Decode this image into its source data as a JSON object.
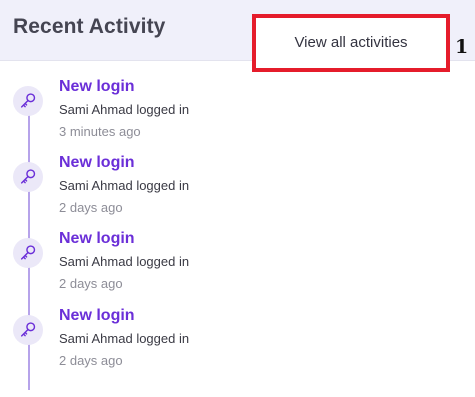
{
  "header": {
    "title": "Recent Activity",
    "view_all_label": "View all activities",
    "annotation_marker": "1"
  },
  "activities": [
    {
      "icon": "key-icon",
      "title": "New login",
      "description": "Sami Ahmad logged in",
      "time": "3 minutes ago"
    },
    {
      "icon": "key-icon",
      "title": "New login",
      "description": "Sami Ahmad logged in",
      "time": "2 days ago"
    },
    {
      "icon": "key-icon",
      "title": "New login",
      "description": "Sami Ahmad logged in",
      "time": "2 days ago"
    },
    {
      "icon": "key-icon",
      "title": "New login",
      "description": "Sami Ahmad logged in",
      "time": "2 days ago"
    }
  ],
  "colors": {
    "accent": "#6b2fd8",
    "timeline": "#b6a3ea",
    "icon_bg": "#ebe8f8",
    "highlight_border": "#e51c2b",
    "header_bg": "#f0f0fa"
  }
}
